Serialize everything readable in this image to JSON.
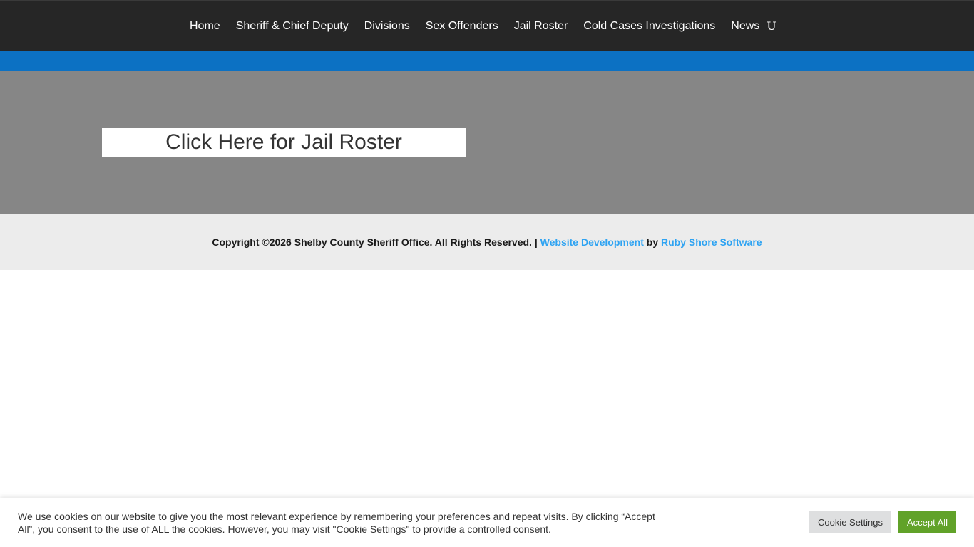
{
  "nav": {
    "items": [
      {
        "label": "Home"
      },
      {
        "label": "Sheriff & Chief Deputy"
      },
      {
        "label": "Divisions"
      },
      {
        "label": "Sex Offenders"
      },
      {
        "label": "Jail Roster"
      },
      {
        "label": "Cold Cases Investigations"
      },
      {
        "label": "News"
      }
    ],
    "more_glyph": "U"
  },
  "hero": {
    "roster_link": "Click Here for Jail Roster"
  },
  "footer": {
    "copyright": "Copyright ©2026 Shelby County Sheriff Office. All Rights Reserved. | ",
    "dev_link": "Website Development",
    "by": " by ",
    "company_link": "Ruby Shore Software"
  },
  "cookie": {
    "message": "We use cookies on our website to give you the most relevant experience by remembering your preferences and repeat visits. By clicking “Accept All”, you consent to the use of ALL the cookies. However, you may visit \"Cookie Settings\" to provide a controlled consent.",
    "settings_label": "Cookie Settings",
    "accept_label": "Accept All"
  },
  "colors": {
    "topbar": "#262626",
    "accent_blue": "#0c71c3",
    "hero_gray": "#868686",
    "footer_bg": "#ececec",
    "link_blue": "#2ea3f2",
    "accept_green": "#61a229"
  }
}
